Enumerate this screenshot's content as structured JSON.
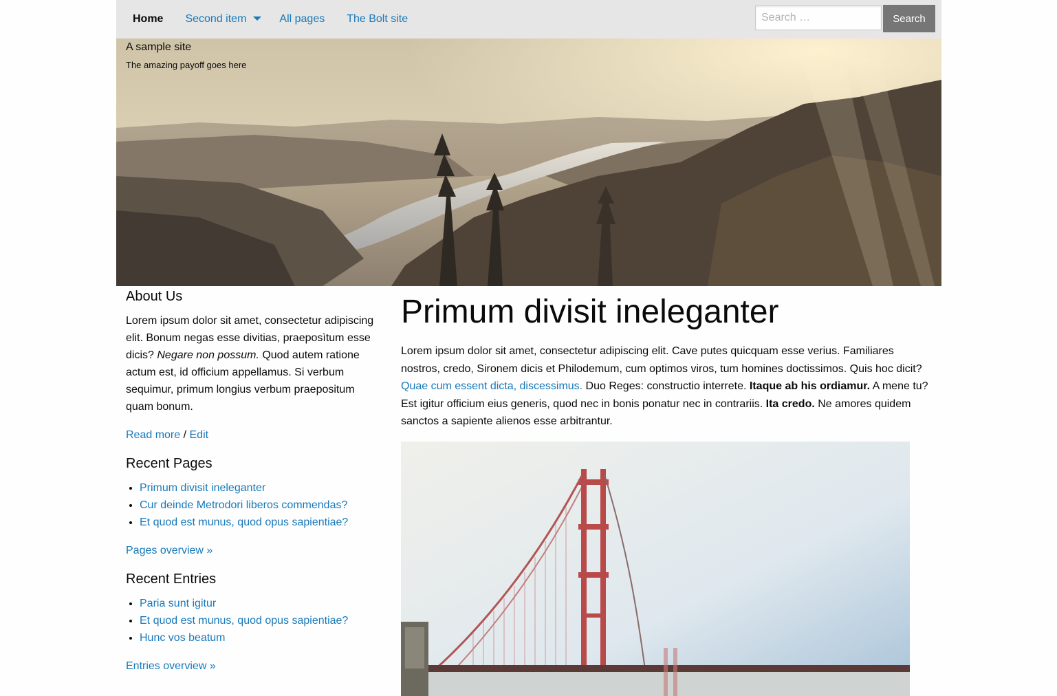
{
  "nav": {
    "items": [
      {
        "label": "Home",
        "active": true
      },
      {
        "label": "Second item",
        "dropdown": true
      },
      {
        "label": "All pages"
      },
      {
        "label": "The Bolt site"
      }
    ],
    "search_placeholder": "Search …",
    "search_button": "Search"
  },
  "hero": {
    "title": "A sample site",
    "payoff": "The amazing payoff goes here"
  },
  "about": {
    "heading": "About Us",
    "text_before": "Lorem ipsum dolor sit amet, consectetur adipiscing elit. Bonum negas esse divitias, praeposìtum esse dicis? ",
    "text_italic": "Negare non possum.",
    "text_after": " Quod autem ratione actum est, id officium appellamus. Si verbum sequimur, primum longius verbum praepositum quam bonum.",
    "read_more": "Read more",
    "separator": " / ",
    "edit": "Edit"
  },
  "recent_pages": {
    "heading": "Recent Pages",
    "items": [
      "Primum divisit ineleganter",
      "Cur deinde Metrodori liberos commendas?",
      "Et quod est munus, quod opus sapientiae?"
    ],
    "overview": "Pages overview »"
  },
  "recent_entries": {
    "heading": "Recent Entries",
    "items": [
      "Paria sunt igitur",
      "Et quod est munus, quod opus sapientiae?",
      "Hunc vos beatum"
    ],
    "overview": "Entries overview »"
  },
  "article": {
    "title": "Primum divisit ineleganter",
    "p1": "Lorem ipsum dolor sit amet, consectetur adipiscing elit. Cave putes quicquam esse verius. Familiares nostros, credo, Sironem dicis et Philodemum, cum optimos viros, tum homines doctissimos. Quis hoc dicit? ",
    "link": "Quae cum essent dicta, discessimus.",
    "p2": " Duo Reges: constructio interrete. ",
    "bold1": "Itaque ab his ordiamur.",
    "p3": " A mene tu? Est igitur officium eius generis, quod nec in bonis ponatur nec in contrariis. ",
    "bold2": "Ita credo.",
    "p4": " Ne amores quidem sanctos a sapiente alienos esse arbitrantur."
  },
  "colors": {
    "link": "#1779ba",
    "topbar": "#e6e6e6",
    "button": "#767676"
  }
}
